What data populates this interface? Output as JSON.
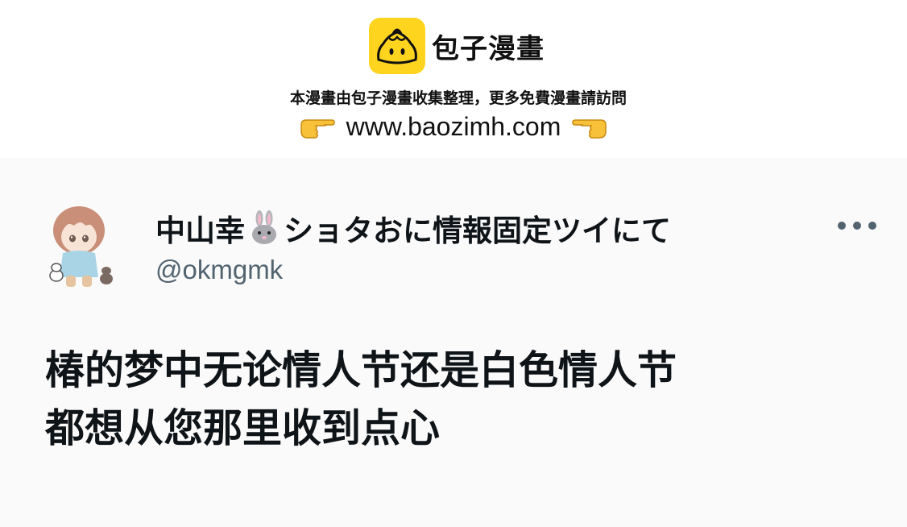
{
  "banner": {
    "brand_name": "包子漫畫",
    "notice": "本漫畫由包子漫畫收集整理，更多免費漫畫請訪問",
    "url": "www.baozimh.com",
    "icons": [
      "baozi-logo-icon",
      "pointing-hand-right-icon",
      "pointing-hand-left-icon"
    ],
    "logo_color": "#ffd41f"
  },
  "tweet": {
    "display_name_part1": "中山幸",
    "display_name_part2": "ショタおに情報固定ツイにて",
    "handle": "@okmgmk",
    "lines": [
      "椿的梦中无论情人节还是白色情人节",
      "都想从您那里收到点心"
    ],
    "icons": [
      "avatar",
      "rabbit-emoji-icon",
      "more-options-icon"
    ],
    "colors": {
      "text": "#0f1419",
      "secondary": "#536471"
    }
  }
}
